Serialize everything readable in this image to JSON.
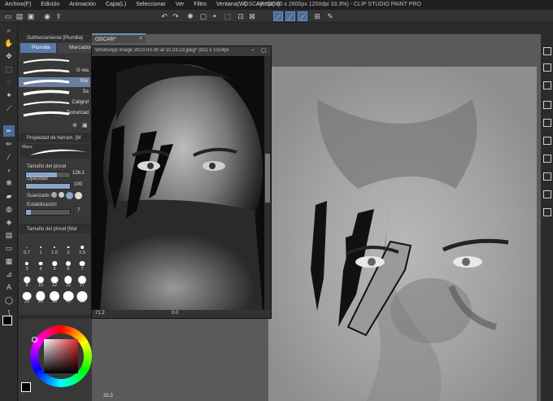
{
  "app": {
    "title": "OSCAR* (2100 x 2800px 1200dpi 33.3%) - CLIP STUDIO PAINT PRO",
    "menu": [
      "Archivo(F)",
      "Edición",
      "Animación",
      "Capa(L)",
      "Seleccionar",
      "Ver",
      "Filtro",
      "Ventana(W)",
      "Ayuda(H)"
    ]
  },
  "document_tab": {
    "label": "OSCAR*"
  },
  "subtool_panel": {
    "title": "Subherramienta [Plumilla]",
    "tabs": [
      "Plumilla",
      "Marcador"
    ],
    "brushes": [
      {
        "name": "G rea"
      },
      {
        "name": "Mar",
        "selected": true
      },
      {
        "name": "Sa"
      },
      {
        "name": "Caligraf"
      },
      {
        "name": "Texturizad"
      }
    ]
  },
  "tool_property": {
    "title": "Propiedad de herram. [M",
    "preview_label": "Maru",
    "brush_size_label": "Tamaño del pincel",
    "brush_size_value": "126.1",
    "opacity_label": "Opacidad",
    "opacity_value": "100",
    "opacity_level": 1.0,
    "brush_size_level": 0.7,
    "smoothing_label": "Suavizado",
    "stabilization_label": "Estabilización",
    "stabilization_value": "7"
  },
  "brush_size_panel": {
    "title": "Tamaño del pincel [Mar",
    "sizes": [
      "0.7",
      "1",
      "1.5",
      "2",
      "2.5",
      "3",
      "4",
      "5",
      "6",
      "7",
      "8",
      "10",
      "12",
      "15",
      "17",
      "20",
      "25",
      "30",
      "40",
      "50"
    ]
  },
  "reference_window": {
    "title": "WhatsApp Image 2023-03-30 at 10.33.23.jpeg* (811 x 1024px",
    "zoom": "71.2",
    "rotation": "0.0"
  },
  "canvas": {
    "zoom": "33.3"
  },
  "colors": {
    "main": "#000000",
    "sub": "#ffffff",
    "accent": "#4a6a9a"
  }
}
